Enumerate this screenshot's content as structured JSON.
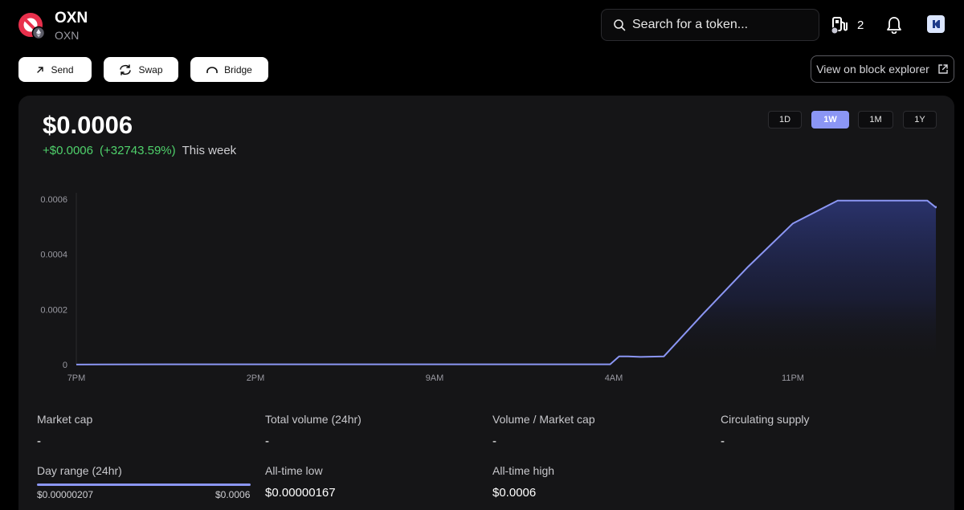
{
  "token": {
    "name": "OXN",
    "symbol": "OXN",
    "brand_color": "#e8304c",
    "chain_badge_color": "#c9c9d6"
  },
  "header": {
    "search_placeholder": "Search for a token...",
    "search_icon": "search-icon",
    "gas_icon": "gas-pump-icon",
    "gas_count": "2",
    "bell_icon": "bell-icon",
    "account_icon": "account-icon"
  },
  "actions": {
    "send_label": "Send",
    "swap_label": "Swap",
    "bridge_label": "Bridge",
    "explorer_label": "View on block explorer",
    "explorer_icon": "external-link-icon"
  },
  "price": {
    "current": "$0.0006",
    "change_abs": "+$0.0006",
    "change_pct": "(+32743.59%)",
    "period": "This week",
    "positive_color": "#4fd16b"
  },
  "time_ranges": [
    {
      "label": "1D",
      "active": false
    },
    {
      "label": "1W",
      "active": true
    },
    {
      "label": "1M",
      "active": false
    },
    {
      "label": "1Y",
      "active": false
    }
  ],
  "accent_color": "#8b96f4",
  "chart_data": {
    "type": "area",
    "title": "",
    "xlabel": "",
    "ylabel": "",
    "x_ticks": [
      "7PM",
      "2PM",
      "9AM",
      "4AM",
      "11PM"
    ],
    "y_ticks": [
      "0",
      "0.0002",
      "0.0004",
      "0.0006"
    ],
    "ylim": [
      0,
      0.0006
    ],
    "grid": false,
    "series": [
      {
        "name": "",
        "color": "#8b96f4",
        "x": [
          0,
          0.5,
          1,
          1.5,
          2,
          2.5,
          2.98,
          3.03,
          3.08,
          3.15,
          3.28,
          3.5,
          3.75,
          4.0,
          4.25,
          4.5,
          4.75,
          4.85,
          5.0,
          5.5,
          5.8
        ],
        "y": [
          5e-07,
          1e-06,
          1e-06,
          1e-06,
          1e-06,
          1e-06,
          1e-06,
          3e-05,
          3e-05,
          2.8e-05,
          3e-05,
          0.000185,
          0.000355,
          0.000512,
          0.000595,
          0.000595,
          0.000595,
          0.00057,
          0.000575,
          0.000575,
          0.000575
        ]
      }
    ]
  },
  "stats": {
    "market_cap": {
      "label": "Market cap",
      "value": "-"
    },
    "total_volume": {
      "label": "Total volume (24hr)",
      "value": "-"
    },
    "volume_market_cap": {
      "label": "Volume / Market cap",
      "value": "-"
    },
    "circulating_supply": {
      "label": "Circulating supply",
      "value": "-"
    },
    "day_range": {
      "label": "Day range (24hr)",
      "low": "$0.00000207",
      "high": "$0.0006"
    },
    "all_time_low": {
      "label": "All-time low",
      "value": "$0.00000167"
    },
    "all_time_high": {
      "label": "All-time high",
      "value": "$0.0006"
    }
  }
}
